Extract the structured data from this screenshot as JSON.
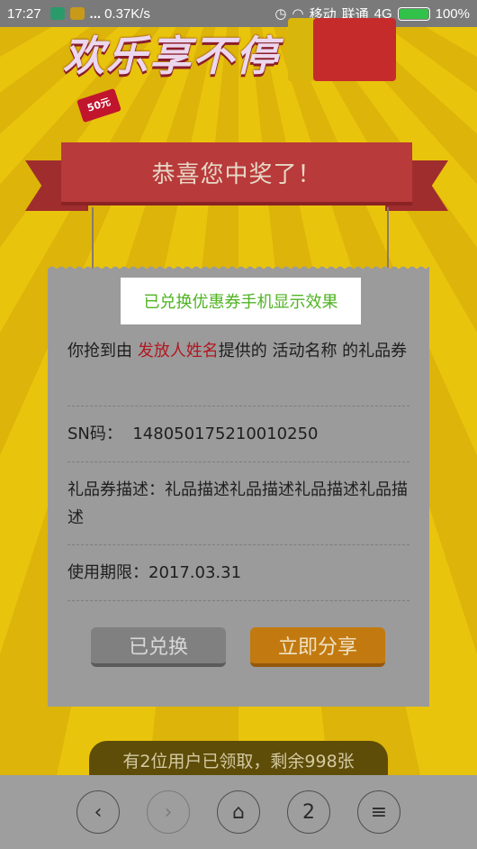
{
  "status_bar": {
    "time": "17:27",
    "speed": "0.37K/s",
    "carrier1": "移动",
    "carrier2": "联通",
    "network": "4G",
    "battery": "100%"
  },
  "hero": {
    "title": "欢乐享不停",
    "badge": "50元"
  },
  "ribbon": {
    "text": "恭喜您中奖了！"
  },
  "card": {
    "title": "已兑换优惠券手机显示效果",
    "line1_prefix": "你抢到由 ",
    "line1_name": "发放人姓名",
    "line1_suffix": "提供的 活动名称 的礼品券",
    "sn_label": "SN码：",
    "sn_value": "148050175210010250",
    "desc_label": "礼品券描述：",
    "desc_value": "礼品描述礼品描述礼品描述礼品描述",
    "expiry_label": "使用期限：",
    "expiry_value": "2017.03.31",
    "btn_used": "已兑换",
    "btn_share": "立即分享"
  },
  "claimed_text": "有2位用户已领取，剩余998张",
  "nav": {
    "back": "‹",
    "forward": "›",
    "home": "⌂",
    "tabs": "2",
    "menu": "≡"
  }
}
